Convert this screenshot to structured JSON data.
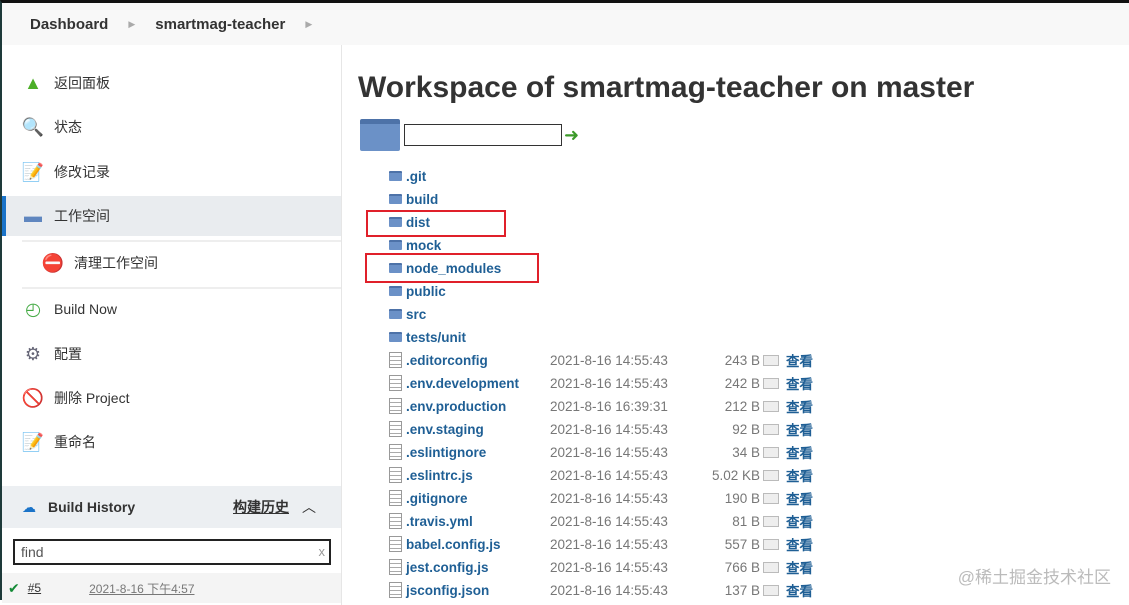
{
  "breadcrumb": [
    "Dashboard",
    "smartmag-teacher"
  ],
  "sidebar": {
    "items": [
      {
        "label": "返回面板",
        "icon": "up-arrow-icon"
      },
      {
        "label": "状态",
        "icon": "search-icon"
      },
      {
        "label": "修改记录",
        "icon": "notepad-icon"
      },
      {
        "label": "工作空间",
        "icon": "folder-icon"
      },
      {
        "label": "清理工作空间",
        "icon": "folder-delete-icon"
      },
      {
        "label": "Build Now",
        "icon": "clock-icon"
      },
      {
        "label": "配置",
        "icon": "gear-icon"
      },
      {
        "label": "删除 Project",
        "icon": "no-entry-icon"
      },
      {
        "label": "重命名",
        "icon": "notepad-icon"
      }
    ]
  },
  "build_history": {
    "title": "Build History",
    "link": "构建历史",
    "find_placeholder": "find",
    "clear": "x",
    "builds": [
      {
        "number": "#5",
        "time": "2021-8-16 下午4:57"
      }
    ]
  },
  "main": {
    "title": "Workspace of smartmag-teacher on master",
    "folders": [
      ".git",
      "build",
      "dist",
      "mock",
      "node_modules",
      "public",
      "src",
      "tests/unit"
    ],
    "view_label": "查看",
    "files": [
      {
        "name": ".editorconfig",
        "date": "2021-8-16 14:55:43",
        "size": "243 B"
      },
      {
        "name": ".env.development",
        "date": "2021-8-16 14:55:43",
        "size": "242 B"
      },
      {
        "name": ".env.production",
        "date": "2021-8-16 16:39:31",
        "size": "212 B"
      },
      {
        "name": ".env.staging",
        "date": "2021-8-16 14:55:43",
        "size": "92 B"
      },
      {
        "name": ".eslintignore",
        "date": "2021-8-16 14:55:43",
        "size": "34 B"
      },
      {
        "name": ".eslintrc.js",
        "date": "2021-8-16 14:55:43",
        "size": "5.02 KB"
      },
      {
        "name": ".gitignore",
        "date": "2021-8-16 14:55:43",
        "size": "190 B"
      },
      {
        "name": ".travis.yml",
        "date": "2021-8-16 14:55:43",
        "size": "81 B"
      },
      {
        "name": "babel.config.js",
        "date": "2021-8-16 14:55:43",
        "size": "557 B"
      },
      {
        "name": "jest.config.js",
        "date": "2021-8-16 14:55:43",
        "size": "766 B"
      },
      {
        "name": "jsconfig.json",
        "date": "2021-8-16 14:55:43",
        "size": "137 B"
      }
    ]
  },
  "watermark": "@稀土掘金技术社区"
}
